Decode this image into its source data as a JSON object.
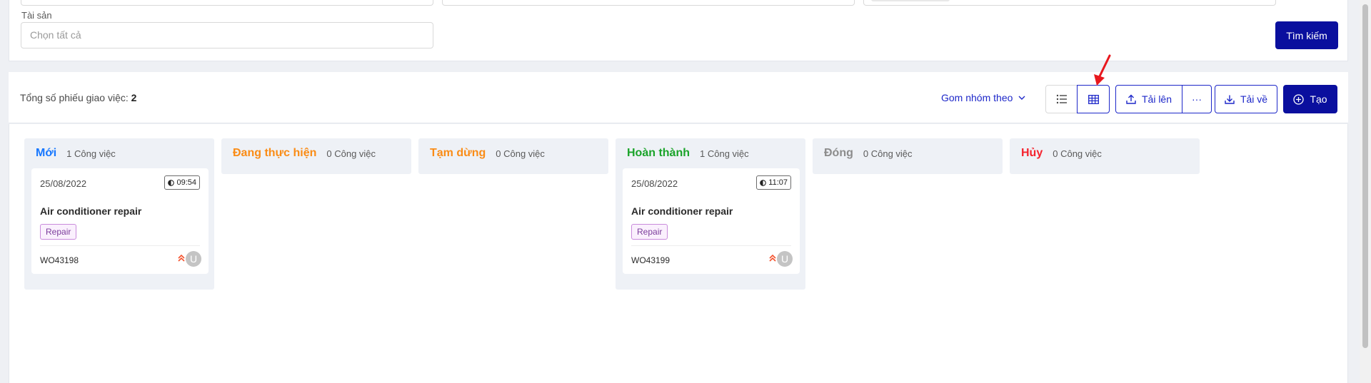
{
  "filters": {
    "asset_label": "Tài sản",
    "asset_placeholder": "Chọn tất cả",
    "search_label": "Tìm kiếm"
  },
  "toolbar": {
    "total_label": "Tổng số phiếu giao việc:",
    "total_value": "2",
    "group_by_label": "Gom nhóm theo",
    "list_view_icon": "list-icon",
    "board_view_icon": "table-grid-icon",
    "upload_label": "Tải lên",
    "more_label": "···",
    "download_label": "Tải về",
    "create_label": "Tạo"
  },
  "columns": [
    {
      "title": "Mới",
      "count": "1 Công việc",
      "color": "#1677ff"
    },
    {
      "title": "Đang thực hiện",
      "count": "0 Công việc",
      "color": "#fa8c16"
    },
    {
      "title": "Tạm dừng",
      "count": "0 Công việc",
      "color": "#fa8c16"
    },
    {
      "title": "Hoàn thành",
      "count": "1 Công việc",
      "color": "#1aa329"
    },
    {
      "title": "Đóng",
      "count": "0 Công việc",
      "color": "#8c8c8c"
    },
    {
      "title": "Hủy",
      "count": "0 Công việc",
      "color": "#f5222d"
    }
  ],
  "cards": [
    {
      "date": "25/08/2022",
      "time": "09:54",
      "title": "Air conditioner repair",
      "tag": "Repair",
      "code": "WO43198",
      "avatar": "U"
    },
    {
      "date": "25/08/2022",
      "time": "11:07",
      "title": "Air conditioner repair",
      "tag": "Repair",
      "code": "WO43199",
      "avatar": "U"
    }
  ],
  "colors": {
    "primary": "#0a0f9e",
    "accent": "#1d27c9",
    "annotation_arrow": "#e8171d",
    "priority": "#f5522d"
  }
}
